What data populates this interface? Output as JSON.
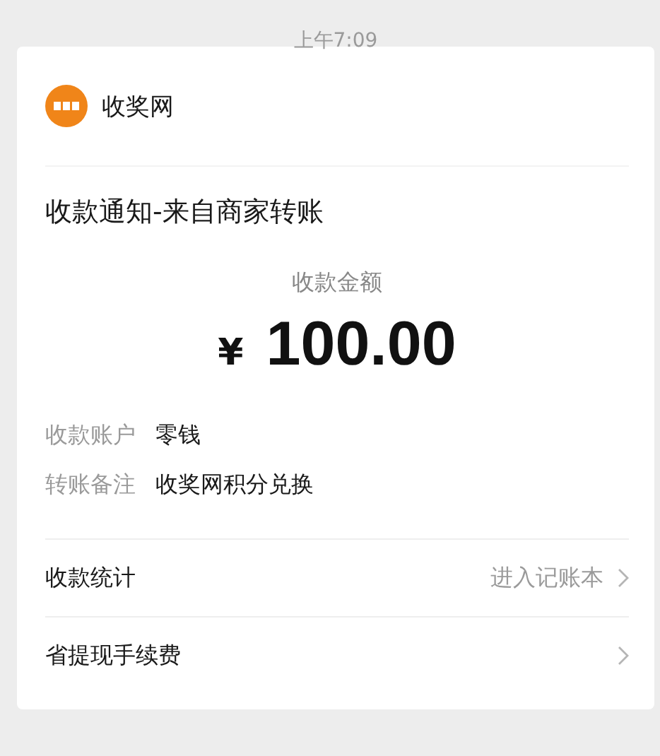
{
  "time": "上午7:09",
  "card": {
    "sender": "收奖网",
    "title": "收款通知-来自商家转账",
    "amount_label": "收款金额",
    "currency": "¥",
    "amount": "100.00",
    "details": [
      {
        "label": "收款账户",
        "value": "零钱"
      },
      {
        "label": "转账备注",
        "value": "收奖网积分兑换"
      }
    ],
    "links": [
      {
        "label": "收款统计",
        "hint": "进入记账本"
      },
      {
        "label": "省提现手续费"
      }
    ]
  }
}
